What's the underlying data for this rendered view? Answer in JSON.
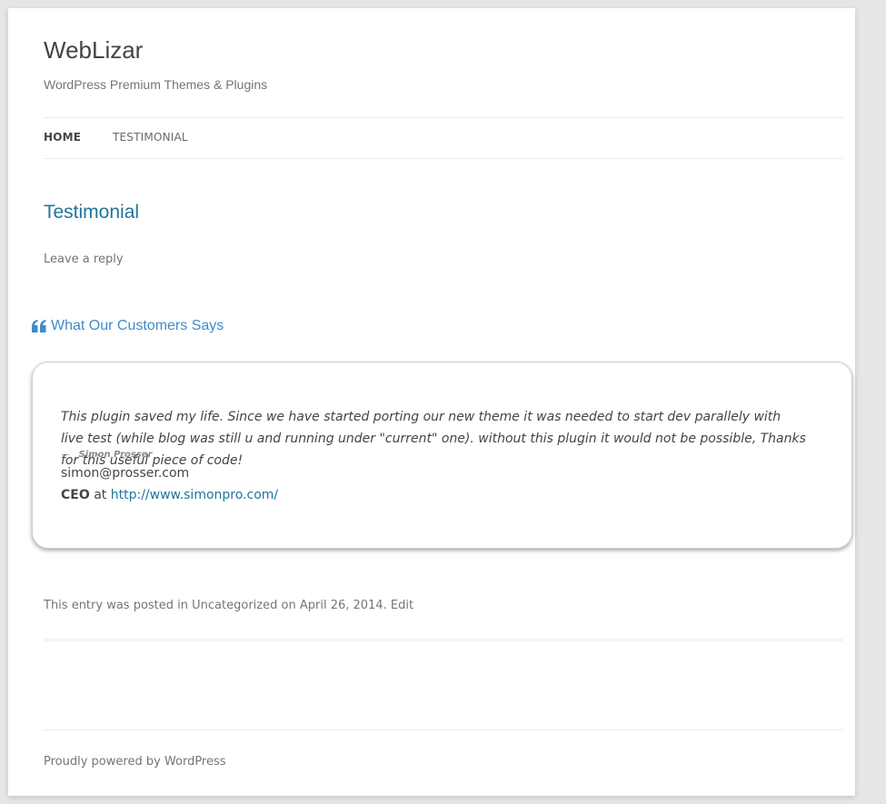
{
  "site": {
    "title": "WebLizar",
    "description": "WordPress Premium Themes & Plugins"
  },
  "nav": {
    "items": [
      {
        "label": "HOME",
        "current": true
      },
      {
        "label": "TESTIMONIAL",
        "current": false
      }
    ]
  },
  "entry": {
    "title": "Testimonial",
    "leave_reply": "Leave a reply"
  },
  "testimonials": {
    "heading": "What Our Customers Says",
    "heading_icon": "quote-left-icon",
    "item": {
      "text": "This plugin saved my life. Since we have started porting our new theme it was needed to start dev parallely with live test (while blog was still u and running under \"current\" one). without this plugin it would not be possible, Thanks for this useful piece of code!",
      "cite_dash": "—",
      "author": "Simon Prosser",
      "email": "simon@prosser.com",
      "role": "CEO",
      "at": "at",
      "website": "http://www.simonpro.com/"
    }
  },
  "meta": {
    "prefix": "This entry was posted in",
    "category": "Uncategorized",
    "on": "on",
    "date": "April 26, 2014",
    "dot": ".",
    "edit": "Edit"
  },
  "footer": {
    "credit": "Proudly powered by WordPress"
  },
  "colors": {
    "accent_link": "#21759b",
    "heading_blue": "#428bca",
    "text": "#444444",
    "muted": "#757575"
  }
}
